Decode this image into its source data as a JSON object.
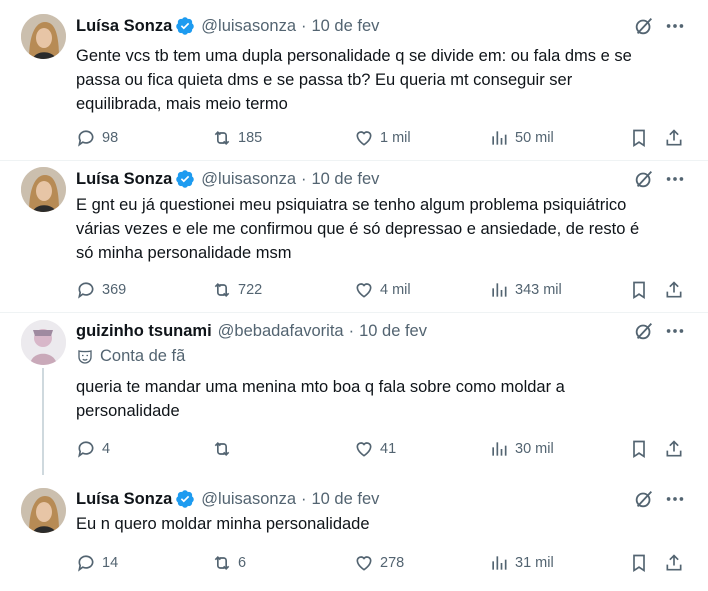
{
  "colors": {
    "accent": "#1d9bf0",
    "muted": "#536471",
    "text": "#0f1419"
  },
  "tweets": [
    {
      "name": "Luísa Sonza",
      "verified": true,
      "handle": "@luisasonza",
      "dot": "·",
      "time": "10 de fev",
      "lines": [
        "Gente vcs tb tem uma dupla personalidade q se divide em: ou fala dms e se",
        "passa ou fica quieta dms e se passa tb? Eu queria mt conseguir ser",
        "equilibrada, mais meio termo"
      ],
      "replies": "98",
      "retweets": "185",
      "likes": "1 mil",
      "views": "50 mil"
    },
    {
      "name": "Luísa Sonza",
      "verified": true,
      "handle": "@luisasonza",
      "dot": "·",
      "time": "10 de fev",
      "lines": [
        "E gnt eu já questionei meu psiquiatra se tenho algum problema psiquiátrico",
        "várias vezes e ele me confirmou que é só depressao e ansiedade, de resto é",
        "só minha personalidade msm"
      ],
      "replies": "369",
      "retweets": "722",
      "likes": "4 mil",
      "views": "343 mil"
    },
    {
      "name": "guizinho tsunami",
      "verified": false,
      "handle": "@bebadafavorita",
      "dot": "·",
      "time": "10 de fev",
      "fan_label": "Conta de fã",
      "lines": [
        "queria te mandar uma menina mto boa q fala sobre como moldar a",
        "personalidade"
      ],
      "replies": "4",
      "retweets": "",
      "likes": "41",
      "views": "30 mil"
    },
    {
      "name": "Luísa Sonza",
      "verified": true,
      "handle": "@luisasonza",
      "dot": "·",
      "time": "10 de fev",
      "lines": [
        "Eu n quero moldar minha personalidade"
      ],
      "replies": "14",
      "retweets": "6",
      "likes": "278",
      "views": "31 mil"
    }
  ]
}
